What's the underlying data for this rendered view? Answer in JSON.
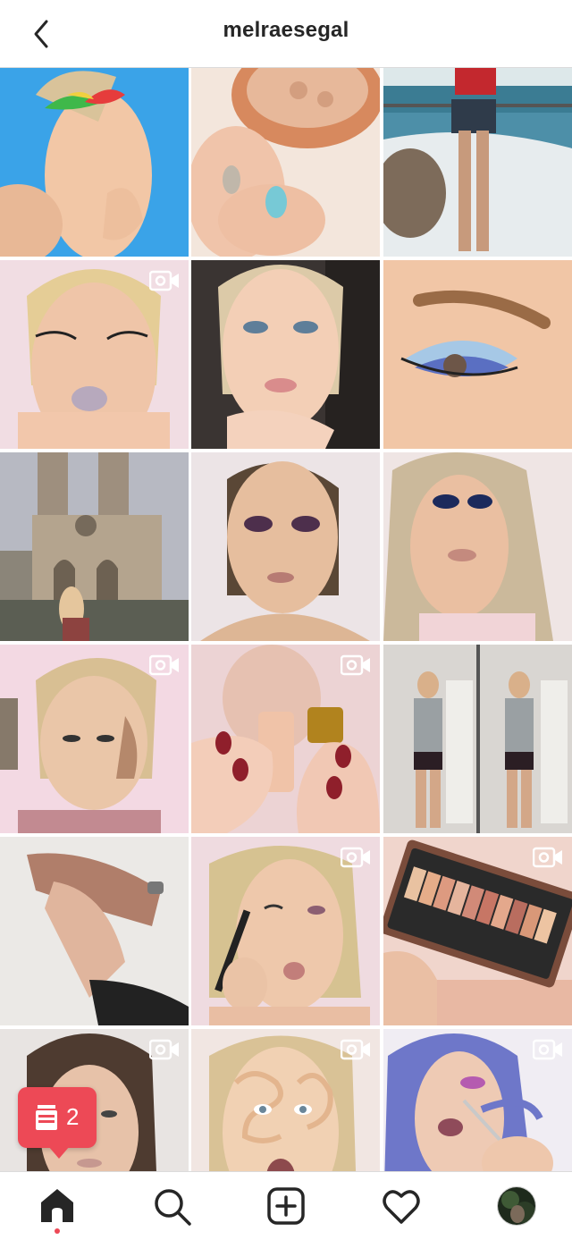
{
  "header": {
    "username": "melraesegal"
  },
  "grid": {
    "tiles": [
      {
        "name": "eyeshadow-rainbow",
        "video": false
      },
      {
        "name": "powder-compact",
        "video": false
      },
      {
        "name": "seaside-photo",
        "video": false
      },
      {
        "name": "glitter-lips",
        "video": true
      },
      {
        "name": "nude-glam",
        "video": false
      },
      {
        "name": "blue-eyeshadow-closeup",
        "video": false
      },
      {
        "name": "notre-dame",
        "video": false
      },
      {
        "name": "smokey-purple",
        "video": false
      },
      {
        "name": "navy-eyeshadow",
        "video": false
      },
      {
        "name": "contour-funny",
        "video": true
      },
      {
        "name": "dropper-bottle",
        "video": true
      },
      {
        "name": "mirror-selfie",
        "video": false
      },
      {
        "name": "holding-hands",
        "video": false
      },
      {
        "name": "brow-pencil",
        "video": true
      },
      {
        "name": "naked-reloaded-palette",
        "video": true
      },
      {
        "name": "bare-face",
        "video": true
      },
      {
        "name": "concealer-swirls",
        "video": true
      },
      {
        "name": "blue-hair",
        "video": true
      }
    ]
  },
  "notification": {
    "count": "2"
  },
  "tabbar": {
    "items": [
      "home-icon",
      "search-icon",
      "new-post-icon",
      "activity-heart-icon",
      "profile-avatar"
    ],
    "active": "home-icon",
    "accent": "#ed4956"
  }
}
